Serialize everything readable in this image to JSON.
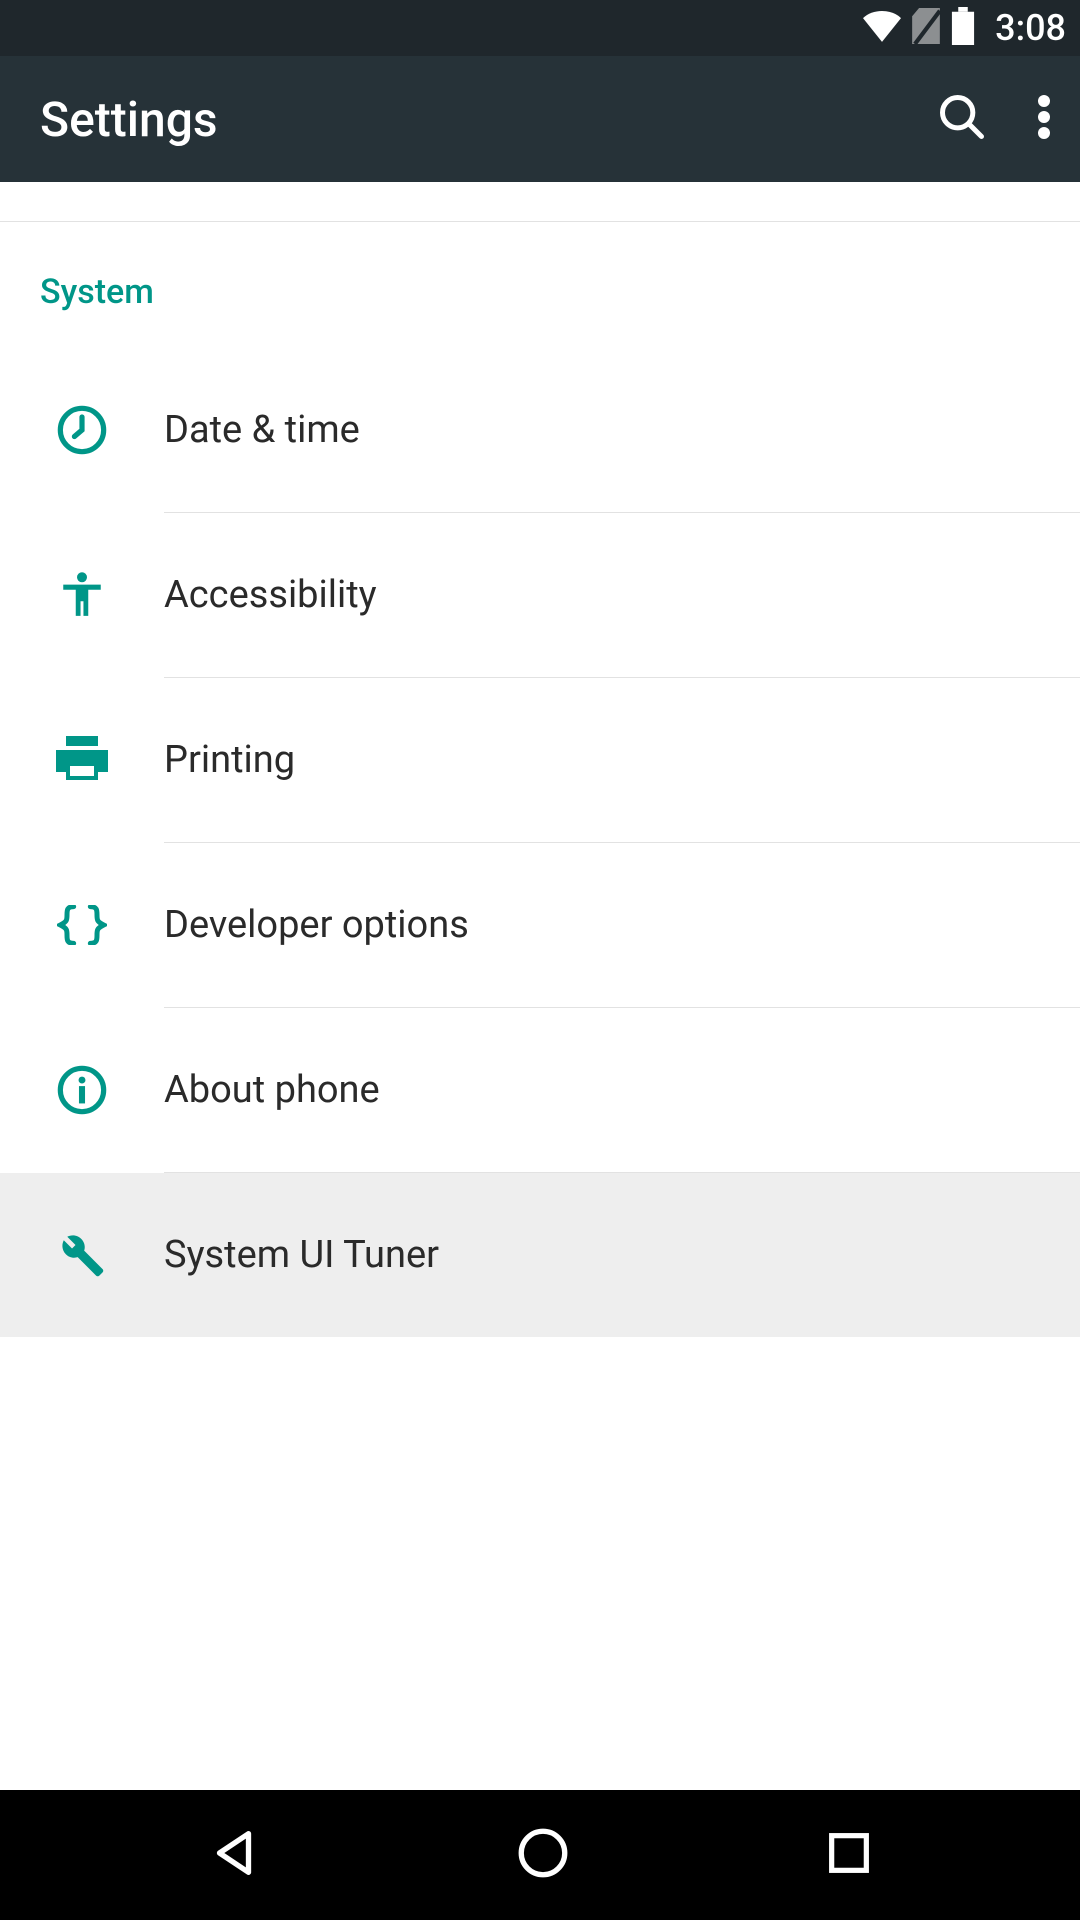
{
  "status": {
    "time": "3:08"
  },
  "appbar": {
    "title": "Settings"
  },
  "section": {
    "title": "System"
  },
  "items": [
    {
      "label": "Date & time",
      "icon": "clock-icon",
      "highlight": false
    },
    {
      "label": "Accessibility",
      "icon": "accessibility-icon",
      "highlight": false
    },
    {
      "label": "Printing",
      "icon": "printer-icon",
      "highlight": false
    },
    {
      "label": "Developer options",
      "icon": "braces-icon",
      "highlight": false
    },
    {
      "label": "About phone",
      "icon": "info-icon",
      "highlight": false
    },
    {
      "label": "System UI Tuner",
      "icon": "wrench-icon",
      "highlight": true
    }
  ],
  "colors": {
    "accent": "#009688",
    "appbar": "#263238",
    "status": "#1f272c",
    "highlight": "#eeeeee"
  }
}
